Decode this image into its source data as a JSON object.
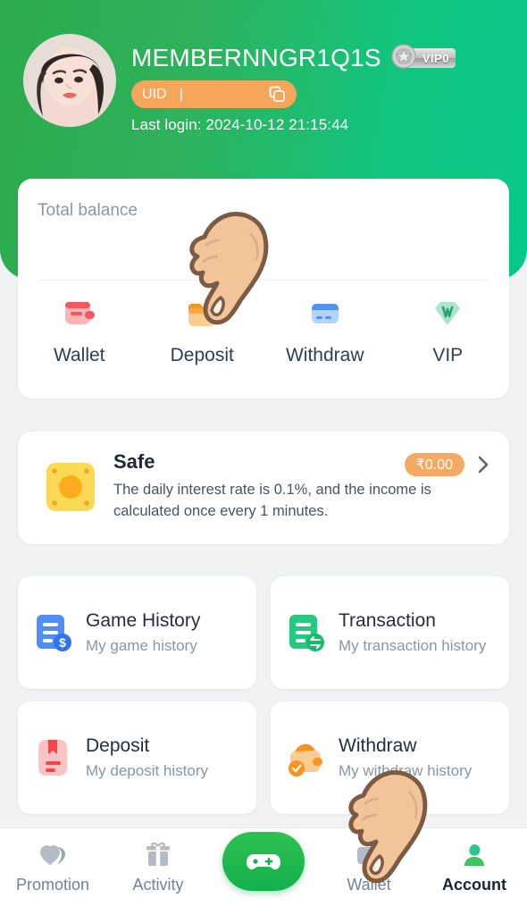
{
  "theme": {
    "header_gradient_start": "#2bab4b",
    "header_gradient_end": "#06c88a",
    "page_background": "#f1f2f3",
    "card_background": "#ffffff",
    "accent_orange": "#f5a65a",
    "accent_green": "#13b04c"
  },
  "header": {
    "username": "MEMBERNNGR1Q1S",
    "vip_badge_label": "VIP0",
    "uid_label": "UID",
    "uid_separator": "|",
    "uid_value": "",
    "copy_icon": "copy-icon",
    "last_login": "Last login: 2024-10-12 21:15:44",
    "avatar_icon": "avatar"
  },
  "balance": {
    "title": "Total balance",
    "amount": "",
    "actions": [
      {
        "label": "Wallet",
        "icon": "wallet-icon"
      },
      {
        "label": "Deposit",
        "icon": "deposit-icon"
      },
      {
        "label": "Withdraw",
        "icon": "withdraw-card-icon"
      },
      {
        "label": "VIP",
        "icon": "vip-diamond-icon"
      }
    ]
  },
  "safe": {
    "icon": "safe-box-icon",
    "title": "Safe",
    "description": "The daily interest rate is 0.1%, and the income is calculated once every 1 minutes.",
    "amount": "₹0.00",
    "chevron_icon": "chevron-right-icon"
  },
  "menu": {
    "items": [
      {
        "title": "Game History",
        "subtitle": "My game history",
        "icon": "game-history-icon"
      },
      {
        "title": "Transaction",
        "subtitle": "My transaction history",
        "icon": "transaction-icon"
      },
      {
        "title": "Deposit",
        "subtitle": "My deposit history",
        "icon": "deposit-history-icon"
      },
      {
        "title": "Withdraw",
        "subtitle": "My withdraw history",
        "icon": "withdraw-history-icon"
      }
    ]
  },
  "tabbar": {
    "items": [
      {
        "label": "Promotion",
        "icon": "promotion-heart-icon",
        "active": false
      },
      {
        "label": "Activity",
        "icon": "gift-icon",
        "active": false
      },
      {
        "label": "",
        "icon": "gamepad-icon",
        "active": false
      },
      {
        "label": "Wallet",
        "icon": "wallet-tab-icon",
        "active": false
      },
      {
        "label": "Account",
        "icon": "account-person-icon",
        "active": true
      }
    ]
  },
  "cursors": [
    {
      "name": "pointing-hand-cursor-deposit",
      "target": "Deposit"
    },
    {
      "name": "pointing-hand-cursor-wallet-tab",
      "target": "Wallet"
    }
  ]
}
